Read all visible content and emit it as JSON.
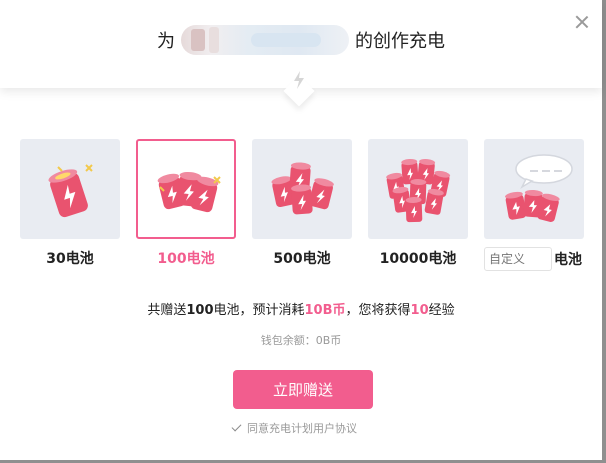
{
  "header": {
    "title_prefix": "为",
    "title_suffix": "的创作充电",
    "close_icon": "close-icon"
  },
  "options": [
    {
      "amount_label": "30电池",
      "icon": "battery-1-icon",
      "selected": false
    },
    {
      "amount_label": "100电池",
      "icon": "battery-3-icon",
      "selected": true
    },
    {
      "amount_label": "500电池",
      "icon": "battery-4-icon",
      "selected": false
    },
    {
      "amount_label": "10000电池",
      "icon": "battery-8-icon",
      "selected": false
    },
    {
      "amount_label": "电池",
      "icon": "battery-custom-icon",
      "selected": false,
      "custom_placeholder": "自定义"
    }
  ],
  "summary": {
    "part1": "共赠送",
    "battery_count": "100",
    "part2": "电池，预计消耗",
    "cost": "10B币",
    "part3": "，您将获得",
    "exp": "10",
    "part4": "经验"
  },
  "wallet": {
    "label": "钱包余额：0B币"
  },
  "submit": {
    "label": "立即赠送"
  },
  "agreement": {
    "label": "同意充电计划用户协议",
    "checked": true
  },
  "colors": {
    "accent": "#f25d8e",
    "battery_body": "#e9536f",
    "battery_cap": "#f08aa0",
    "card_bg": "#e9ecf2"
  }
}
